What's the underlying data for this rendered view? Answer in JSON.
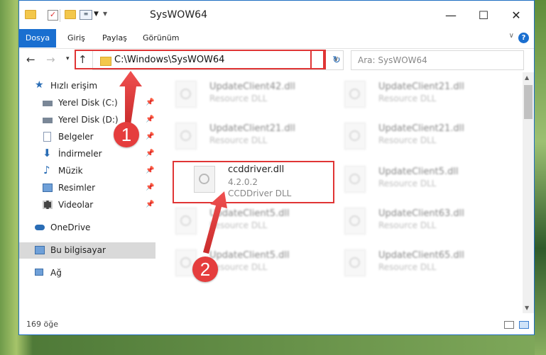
{
  "window": {
    "title": "SysWOW64"
  },
  "ribbon": {
    "tabs": [
      "Dosya",
      "Giriş",
      "Paylaş",
      "Görünüm"
    ]
  },
  "address": {
    "path": "C:\\Windows\\SysWOW64",
    "search_placeholder": "Ara: SysWOW64"
  },
  "nav": {
    "quick_access": "Hızlı erişim",
    "items": [
      "Yerel Disk (C:)",
      "Yerel Disk (D:)",
      "Belgeler",
      "İndirmeler",
      "Müzik",
      "Resimler",
      "Videolar"
    ],
    "onedrive": "OneDrive",
    "this_pc": "Bu bilgisayar",
    "network": "Ağ"
  },
  "files": {
    "row1_left": {
      "name": "UpdateClient42.dll",
      "type": "Resource DLL"
    },
    "row1_right": {
      "name": "UpdateClient21.dll",
      "type": "Resource DLL"
    },
    "row2_left": {
      "name": "UpdateClient21.dll",
      "type": "Resource DLL"
    },
    "row2_right": {
      "name": "UpdateClient21.dll",
      "type": "Resource DLL"
    },
    "highlight": {
      "name": "ccddriver.dll",
      "version": "4.2.0.2",
      "type": "CCDDriver DLL"
    },
    "row3_right": {
      "name": "UpdateClient5.dll",
      "type": "Resource DLL"
    },
    "row4_left": {
      "name": "UpdateClient5.dll",
      "type": "Resource DLL"
    },
    "row4_right": {
      "name": "UpdateClient63.dll",
      "type": "Resource DLL"
    },
    "row5_left": {
      "name": "UpdateClient5.dll",
      "type": "Resource DLL"
    },
    "row5_right": {
      "name": "UpdateClient65.dll",
      "type": "Resource DLL"
    }
  },
  "status": {
    "count": "169 öğe"
  },
  "callouts": {
    "one": "1",
    "two": "2"
  },
  "colors": {
    "accent": "#1a6fd0",
    "highlight_red": "#e03535"
  }
}
